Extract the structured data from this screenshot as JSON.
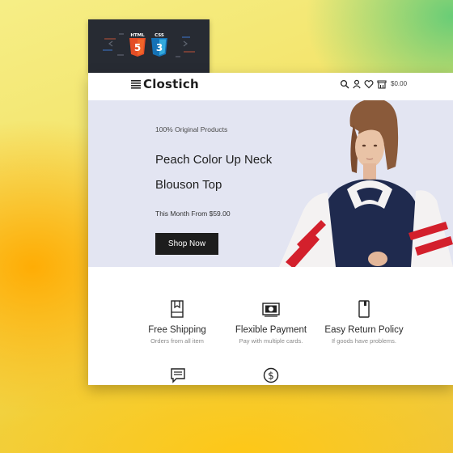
{
  "badge": {
    "html_label": "HTML",
    "css_label": "CSS",
    "html_number": "5",
    "css_number": "3"
  },
  "nav": {
    "brand": "Clostich",
    "cart_total": "$0.00"
  },
  "hero": {
    "eyebrow": "100% Original Products",
    "title": "Peach Color Up Neck Blouson Top",
    "price_text": "This Month From $59.00",
    "cta_label": "Shop Now"
  },
  "features": [
    {
      "icon": "bookmark-icon",
      "title": "Free Shipping",
      "subtitle": "Orders from all item"
    },
    {
      "icon": "money-icon",
      "title": "Flexible Payment",
      "subtitle": "Pay with multiple cards."
    },
    {
      "icon": "phone-icon",
      "title": "Easy Return Policy",
      "subtitle": "If goods have problems."
    },
    {
      "icon": "chat-icon",
      "title": "",
      "subtitle": ""
    },
    {
      "icon": "dollar-icon",
      "title": "",
      "subtitle": ""
    }
  ],
  "colors": {
    "hero_bg": "#e3e5f2",
    "button_bg": "#1d1d1d",
    "html5_orange": "#e44d26",
    "css3_blue": "#2965f1",
    "badge_bg": "#272b33"
  }
}
